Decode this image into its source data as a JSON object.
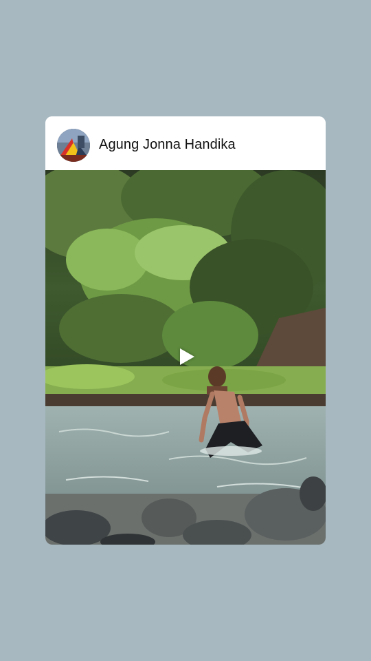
{
  "post": {
    "author_name": "Agung Jonna Handika",
    "avatar_icon": "profile-avatar",
    "media_type": "video",
    "play_icon": "play-icon"
  },
  "colors": {
    "page_background": "#a7b8c1",
    "card_background": "#ffffff",
    "author_text": "#111111"
  }
}
